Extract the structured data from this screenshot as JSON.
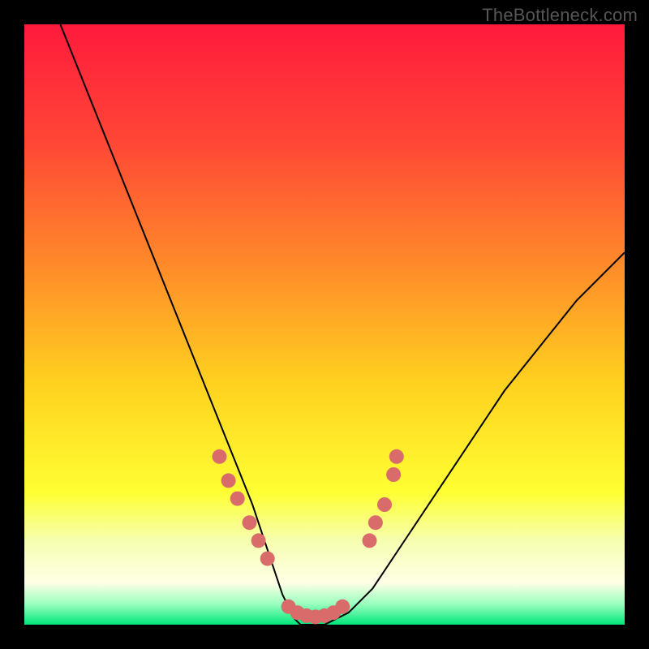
{
  "watermark": "TheBottleneck.com",
  "chart_data": {
    "type": "line",
    "title": "",
    "xlabel": "",
    "ylabel": "",
    "xlim": [
      0,
      100
    ],
    "ylim": [
      0,
      100
    ],
    "background_gradient": {
      "stops": [
        {
          "offset": 0.0,
          "color": "#ff1a3c"
        },
        {
          "offset": 0.2,
          "color": "#ff4836"
        },
        {
          "offset": 0.4,
          "color": "#ff8a2a"
        },
        {
          "offset": 0.6,
          "color": "#ffd21f"
        },
        {
          "offset": 0.78,
          "color": "#ffff33"
        },
        {
          "offset": 0.86,
          "color": "#f6ffb0"
        },
        {
          "offset": 0.93,
          "color": "#ffffe6"
        },
        {
          "offset": 0.965,
          "color": "#9cffbf"
        },
        {
          "offset": 1.0,
          "color": "#00e67a"
        }
      ]
    },
    "series": [
      {
        "name": "bottleneck-curve",
        "color": "#000000",
        "x": [
          6,
          8,
          10,
          12,
          14,
          16,
          18,
          20,
          22,
          24,
          26,
          28,
          30,
          32,
          34,
          36,
          38,
          40,
          42,
          43,
          44,
          45,
          46,
          48,
          50,
          52,
          54,
          56,
          58,
          60,
          64,
          68,
          72,
          76,
          80,
          84,
          88,
          92,
          96,
          100
        ],
        "y": [
          100,
          95,
          90,
          85,
          80,
          75,
          70,
          65,
          60,
          55,
          50,
          45,
          40,
          35,
          30,
          25,
          20,
          14,
          8,
          5,
          3,
          1,
          0,
          0,
          0,
          1,
          2,
          4,
          6,
          9,
          15,
          21,
          27,
          33,
          39,
          44,
          49,
          54,
          58,
          62
        ]
      }
    ],
    "markers": {
      "color": "#d96b6b",
      "radius": 9,
      "points": [
        {
          "x": 32.5,
          "y": 28
        },
        {
          "x": 34.0,
          "y": 24
        },
        {
          "x": 35.5,
          "y": 21
        },
        {
          "x": 37.5,
          "y": 17
        },
        {
          "x": 39.0,
          "y": 14
        },
        {
          "x": 40.5,
          "y": 11
        },
        {
          "x": 44.0,
          "y": 3
        },
        {
          "x": 45.5,
          "y": 2
        },
        {
          "x": 47.0,
          "y": 1.5
        },
        {
          "x": 48.5,
          "y": 1.3
        },
        {
          "x": 50.0,
          "y": 1.5
        },
        {
          "x": 51.5,
          "y": 2
        },
        {
          "x": 53.0,
          "y": 3
        },
        {
          "x": 57.5,
          "y": 14
        },
        {
          "x": 58.5,
          "y": 17
        },
        {
          "x": 60.0,
          "y": 20
        },
        {
          "x": 61.5,
          "y": 25
        },
        {
          "x": 62.0,
          "y": 28
        }
      ]
    }
  }
}
